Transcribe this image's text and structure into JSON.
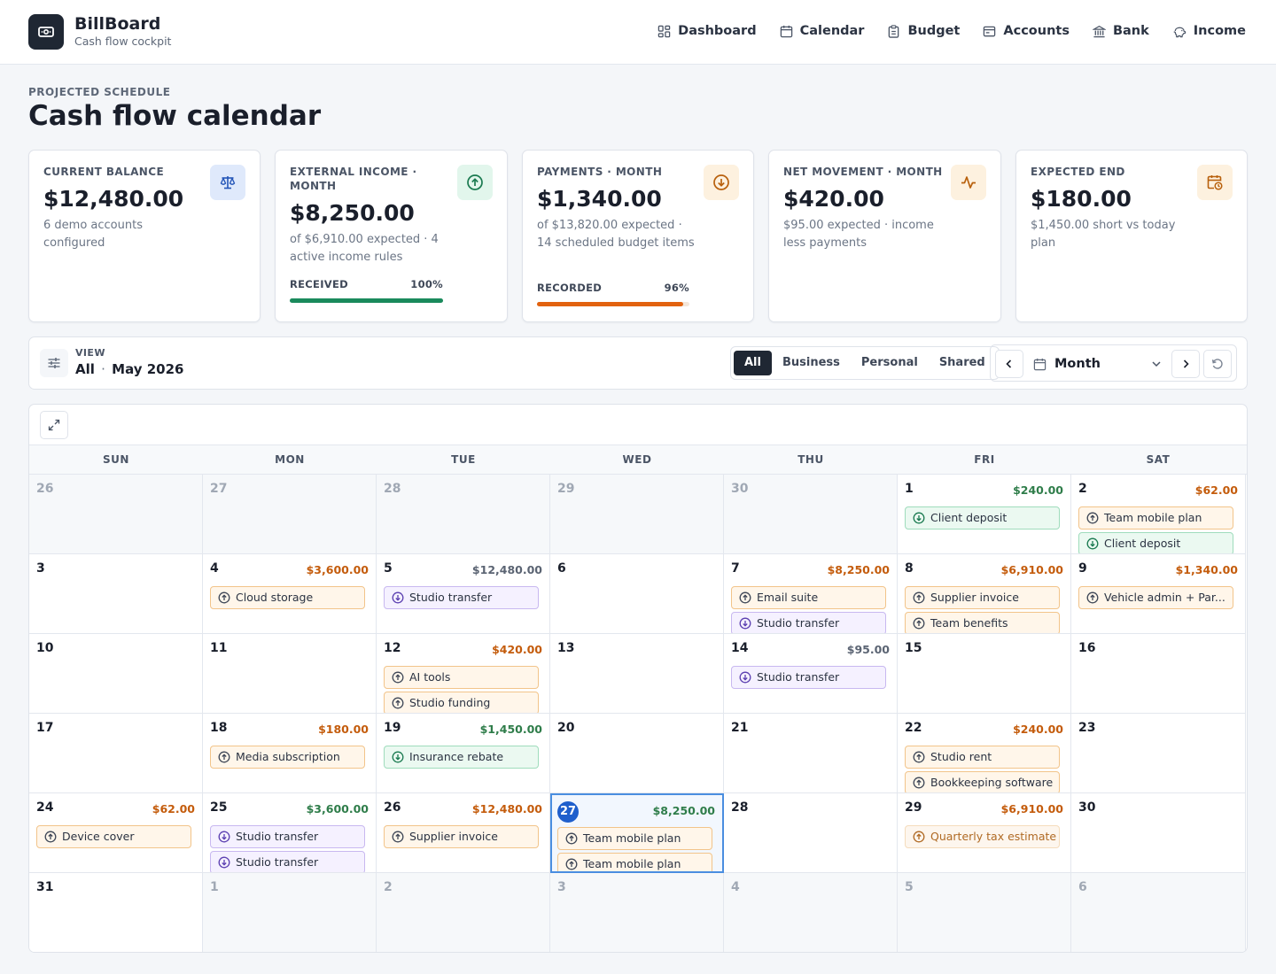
{
  "brand": {
    "name": "BillBoard",
    "subtitle": "Cash flow cockpit"
  },
  "nav": [
    {
      "label": "Dashboard",
      "icon": "dashboard-icon"
    },
    {
      "label": "Calendar",
      "icon": "calendar-icon"
    },
    {
      "label": "Budget",
      "icon": "clipboard-icon"
    },
    {
      "label": "Accounts",
      "icon": "wallet-icon"
    },
    {
      "label": "Bank",
      "icon": "bank-icon"
    },
    {
      "label": "Income",
      "icon": "piggy-icon"
    }
  ],
  "page": {
    "eyebrow": "PROJECTED SCHEDULE",
    "title": "Cash flow calendar"
  },
  "cards": [
    {
      "label": "CURRENT BALANCE",
      "value": "$12,480.00",
      "note": "6 demo accounts configured",
      "icon": "scale-icon",
      "icon_bg": "#dfe9fb",
      "icon_color": "#2456b8"
    },
    {
      "label": "EXTERNAL INCOME · MONTH",
      "value": "$8,250.00",
      "note": "of $6,910.00 expected · 4 active income rules",
      "bar_label": "RECEIVED",
      "bar_pct_label": "100%",
      "bar_fraction": 1.0,
      "bar_color": "#1a8a5c",
      "icon": "arrow-up-circle-icon",
      "icon_bg": "#e2f6ec",
      "icon_color": "#1a7a50"
    },
    {
      "label": "PAYMENTS · MONTH",
      "value": "$1,340.00",
      "note": "of $13,820.00 expected · 14 scheduled budget items",
      "bar_label": "RECORDED",
      "bar_pct_label": "96%",
      "bar_fraction": 0.96,
      "bar_color": "#e2620f",
      "icon": "arrow-down-circle-icon",
      "icon_bg": "#fdf1df",
      "icon_color": "#b8600c"
    },
    {
      "label": "NET MOVEMENT · MONTH",
      "value": "$420.00",
      "note": "$95.00 expected · income less payments",
      "icon": "activity-icon",
      "icon_bg": "#fdf1df",
      "icon_color": "#b8600c"
    },
    {
      "label": "EXPECTED END",
      "value": "$180.00",
      "note": "$1,450.00 short vs today plan",
      "icon": "calendar-clock-icon",
      "icon_bg": "#fdf1df",
      "icon_color": "#b8600c"
    }
  ],
  "view": {
    "label": "VIEW",
    "scope": "All",
    "separator": "·",
    "month": "May 2026",
    "filters": [
      "All",
      "Business",
      "Personal",
      "Shared"
    ],
    "active_filter": "All",
    "period": "Month"
  },
  "calendar": {
    "weekdays": [
      "SUN",
      "MON",
      "TUE",
      "WED",
      "THU",
      "FRI",
      "SAT"
    ],
    "weeks": [
      [
        {
          "day": "26",
          "out": true
        },
        {
          "day": "27",
          "out": true
        },
        {
          "day": "28",
          "out": true
        },
        {
          "day": "29",
          "out": true
        },
        {
          "day": "30",
          "out": true
        },
        {
          "day": "1",
          "amount": "$240.00",
          "amount_kind": "in",
          "events": [
            {
              "label": "Client deposit",
              "kind": "inc"
            }
          ]
        },
        {
          "day": "2",
          "amount": "$62.00",
          "amount_kind": "out",
          "events": [
            {
              "label": "Team mobile plan",
              "kind": "pay"
            },
            {
              "label": "Client deposit",
              "kind": "inc"
            }
          ]
        }
      ],
      [
        {
          "day": "3"
        },
        {
          "day": "4",
          "amount": "$3,600.00",
          "amount_kind": "out",
          "events": [
            {
              "label": "Cloud storage",
              "kind": "pay"
            }
          ]
        },
        {
          "day": "5",
          "amount": "$12,480.00",
          "amount_kind": "neutral",
          "events": [
            {
              "label": "Studio transfer",
              "kind": "xfer"
            }
          ]
        },
        {
          "day": "6"
        },
        {
          "day": "7",
          "amount": "$8,250.00",
          "amount_kind": "out",
          "events": [
            {
              "label": "Email suite",
              "kind": "pay"
            },
            {
              "label": "Studio transfer",
              "kind": "xfer"
            }
          ]
        },
        {
          "day": "8",
          "amount": "$6,910.00",
          "amount_kind": "out",
          "events": [
            {
              "label": "Supplier invoice",
              "kind": "pay"
            },
            {
              "label": "Team benefits",
              "kind": "pay"
            }
          ]
        },
        {
          "day": "9",
          "amount": "$1,340.00",
          "amount_kind": "out",
          "events": [
            {
              "label": "Vehicle admin + Par...",
              "kind": "pay"
            }
          ]
        }
      ],
      [
        {
          "day": "10"
        },
        {
          "day": "11"
        },
        {
          "day": "12",
          "amount": "$420.00",
          "amount_kind": "out",
          "events": [
            {
              "label": "AI tools",
              "kind": "pay"
            },
            {
              "label": "Studio funding",
              "kind": "pay"
            }
          ]
        },
        {
          "day": "13"
        },
        {
          "day": "14",
          "amount": "$95.00",
          "amount_kind": "neutral",
          "events": [
            {
              "label": "Studio transfer",
              "kind": "xfer"
            }
          ]
        },
        {
          "day": "15"
        },
        {
          "day": "16"
        }
      ],
      [
        {
          "day": "17"
        },
        {
          "day": "18",
          "amount": "$180.00",
          "amount_kind": "out",
          "events": [
            {
              "label": "Media subscription",
              "kind": "pay"
            }
          ]
        },
        {
          "day": "19",
          "amount": "$1,450.00",
          "amount_kind": "in",
          "events": [
            {
              "label": "Insurance rebate",
              "kind": "inc"
            }
          ]
        },
        {
          "day": "20"
        },
        {
          "day": "21"
        },
        {
          "day": "22",
          "amount": "$240.00",
          "amount_kind": "out",
          "events": [
            {
              "label": "Studio rent",
              "kind": "pay"
            },
            {
              "label": "Bookkeeping software",
              "kind": "pay"
            }
          ]
        },
        {
          "day": "23"
        }
      ],
      [
        {
          "day": "24",
          "amount": "$62.00",
          "amount_kind": "out",
          "events": [
            {
              "label": "Device cover",
              "kind": "pay"
            }
          ]
        },
        {
          "day": "25",
          "amount": "$3,600.00",
          "amount_kind": "in",
          "events": [
            {
              "label": "Studio transfer",
              "kind": "xfer"
            },
            {
              "label": "Studio transfer",
              "kind": "xfer"
            }
          ]
        },
        {
          "day": "26",
          "amount": "$12,480.00",
          "amount_kind": "out",
          "events": [
            {
              "label": "Supplier invoice",
              "kind": "pay"
            }
          ]
        },
        {
          "day": "27",
          "today": true,
          "amount": "$8,250.00",
          "amount_kind": "in",
          "events": [
            {
              "label": "Team mobile plan",
              "kind": "pay"
            },
            {
              "label": "Team mobile plan",
              "kind": "pay"
            }
          ]
        },
        {
          "day": "28"
        },
        {
          "day": "29",
          "amount": "$6,910.00",
          "amount_kind": "out",
          "events": [
            {
              "label": "Quarterly tax estimate",
              "kind": "muted"
            }
          ]
        },
        {
          "day": "30"
        }
      ],
      [
        {
          "day": "31"
        },
        {
          "day": "1",
          "out": true
        },
        {
          "day": "2",
          "out": true
        },
        {
          "day": "3",
          "out": true
        },
        {
          "day": "4",
          "out": true
        },
        {
          "day": "5",
          "out": true
        },
        {
          "day": "6",
          "out": true
        }
      ]
    ]
  }
}
